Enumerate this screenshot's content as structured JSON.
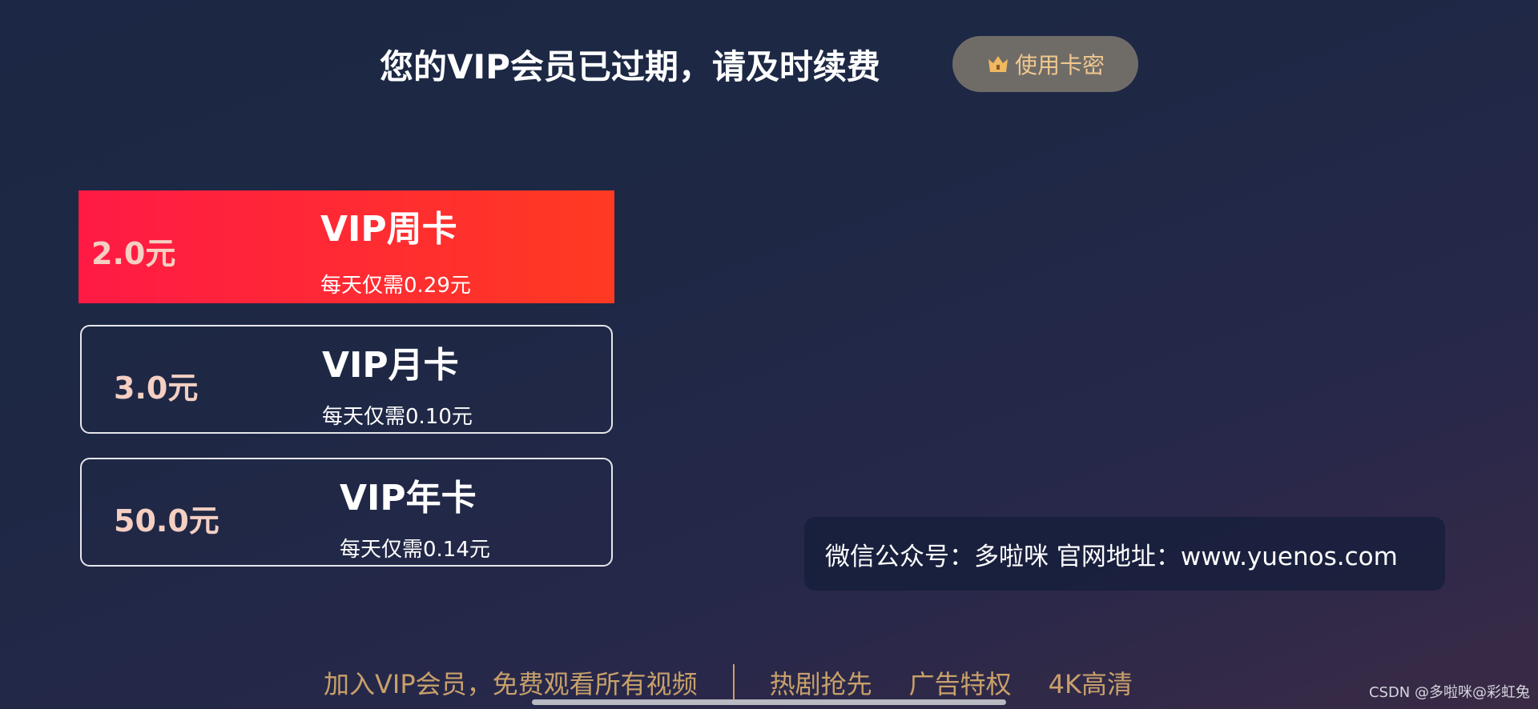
{
  "header": {
    "title": "您的VIP会员已过期，请及时续费",
    "card_key_button": {
      "icon": "crown-icon",
      "label": "使用卡密"
    }
  },
  "plans": [
    {
      "price": "2.0元",
      "name": "VIP周卡",
      "daily": "每天仅需0.29元",
      "selected": true
    },
    {
      "price": "3.0元",
      "name": "VIP月卡",
      "daily": "每天仅需0.10元",
      "selected": false
    },
    {
      "price": "50.0元",
      "name": "VIP年卡",
      "daily": "每天仅需0.14元",
      "selected": false
    }
  ],
  "info": {
    "text": "微信公众号：多啦咪 官网地址：www.yuenos.com"
  },
  "footer": {
    "slogan": "加入VIP会员，免费观看所有视频",
    "perks": [
      "热剧抢先",
      "广告特权",
      "4K高清"
    ]
  },
  "watermark": "CSDN @多啦咪@彩虹兔",
  "colors": {
    "selected_gradient_start": "#ff1a45",
    "selected_gradient_end": "#ff3a22",
    "gold_text": "#c8a06a",
    "price_text": "#f4cfc2",
    "button_bg": "#6f6c68",
    "button_text": "#f0c88e"
  }
}
